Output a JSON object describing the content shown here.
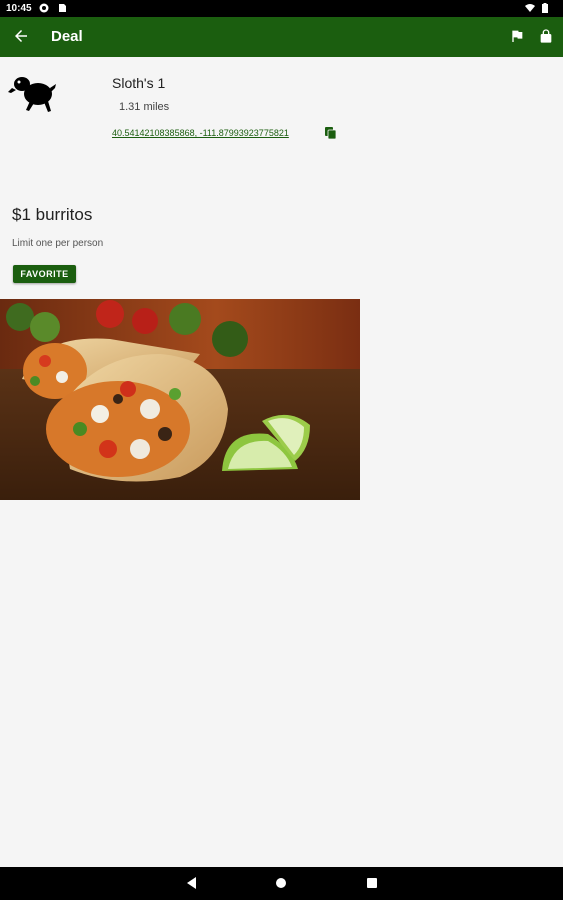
{
  "status_bar": {
    "time": "10:45",
    "icons": [
      "notification-icon",
      "sd-card-icon",
      "wifi-icon",
      "battery-icon"
    ]
  },
  "app_bar": {
    "title": "Deal",
    "color": "#1b5e0f",
    "icons": [
      "back-arrow-icon",
      "flag-icon",
      "lock-icon"
    ]
  },
  "place": {
    "name": "Sloth's 1",
    "distance": "1.31 miles",
    "coordinates": "40.54142108385868, -111.87993923775821",
    "logo": "sloth-logo-icon"
  },
  "deal": {
    "title": "$1 burritos",
    "description": "Limit one per person",
    "favorite_label": "FAVORITE"
  },
  "nav_bar": {
    "icons": [
      "back-triangle-icon",
      "home-circle-icon",
      "recents-square-icon"
    ]
  }
}
